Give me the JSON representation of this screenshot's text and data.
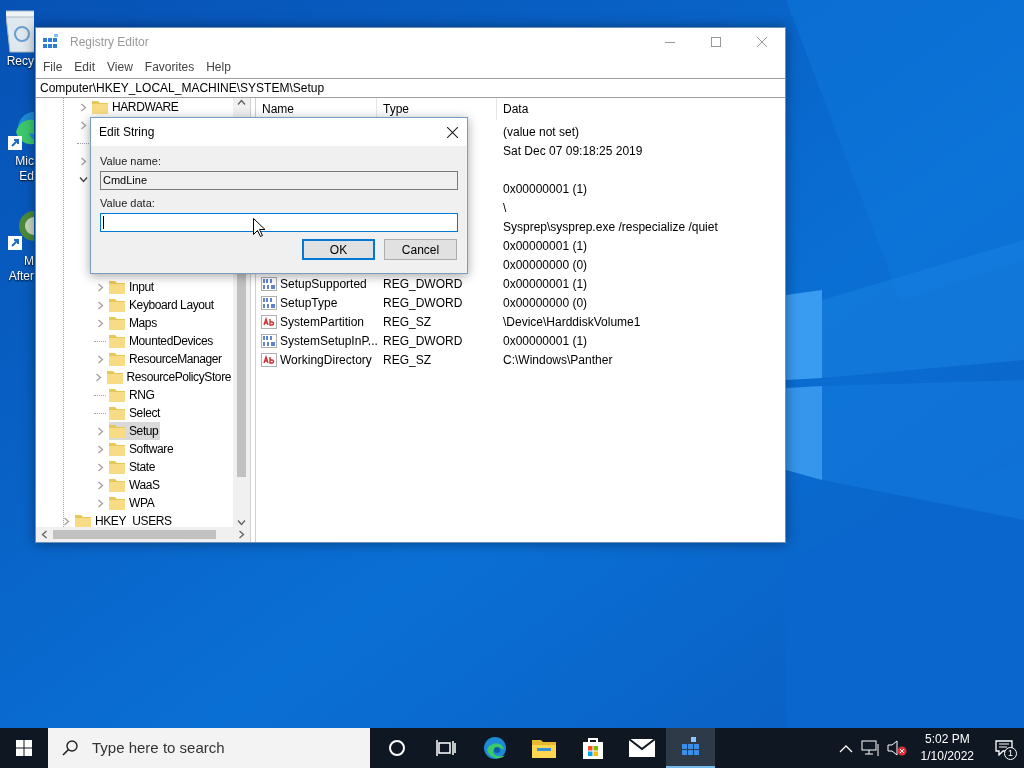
{
  "desktop_icons": [
    {
      "kind": "recycle-bin",
      "lines": [
        "Recy"
      ]
    },
    {
      "kind": "edge",
      "lines": [
        "Mic",
        "Ed"
      ]
    },
    {
      "kind": "app",
      "lines": [
        "M",
        "After"
      ]
    }
  ],
  "window": {
    "title": "Registry Editor",
    "menu": [
      "File",
      "Edit",
      "View",
      "Favorites",
      "Help"
    ],
    "address": "Computer\\HKEY_LOCAL_MACHINE\\SYSTEM\\Setup",
    "tree": {
      "items": [
        {
          "children": [
            {
              "label": "HARDWARE",
              "kind": "branch",
              "expanded": false,
              "selected": false
            },
            {
              "kind": "branch",
              "expanded": false
            },
            {
              "kind": "leaf"
            },
            {
              "kind": "branch",
              "expanded": false
            },
            {
              "kind": "branch",
              "expanded": true,
              "children": [
                {
                  "label": "Input",
                  "kind": "branch",
                  "expanded": false,
                  "selected": false
                },
                {
                  "label": "Keyboard Layout",
                  "kind": "branch",
                  "expanded": false,
                  "selected": false
                },
                {
                  "label": "Maps",
                  "kind": "branch",
                  "expanded": false,
                  "selected": false
                },
                {
                  "label": "MountedDevices",
                  "kind": "leaf",
                  "selected": false
                },
                {
                  "label": "ResourceManager",
                  "kind": "branch",
                  "expanded": false,
                  "selected": false
                },
                {
                  "label": "ResourcePolicyStore",
                  "kind": "branch",
                  "expanded": false,
                  "selected": false
                },
                {
                  "label": "RNG",
                  "kind": "leaf",
                  "selected": false
                },
                {
                  "label": "Select",
                  "kind": "leaf",
                  "selected": false
                },
                {
                  "label": "Setup",
                  "kind": "branch",
                  "expanded": false,
                  "selected": true
                },
                {
                  "label": "Software",
                  "kind": "branch",
                  "expanded": false,
                  "selected": false
                },
                {
                  "label": "State",
                  "kind": "branch",
                  "expanded": false,
                  "selected": false
                },
                {
                  "label": "WaaS",
                  "kind": "branch",
                  "expanded": false,
                  "selected": false
                },
                {
                  "label": "WPA",
                  "kind": "branch",
                  "expanded": false,
                  "selected": false
                }
              ]
            }
          ]
        },
        {
          "label": "HKEY_USERS",
          "kind": "branch",
          "expanded": false,
          "selected": false
        }
      ]
    },
    "list": {
      "columns": [
        "Name",
        "Type",
        "Data"
      ],
      "rows": [
        {
          "data": "(value not set)"
        },
        {
          "data": "Sat Dec 07 09:18:25 2019"
        },
        {
          "kind": "blank"
        },
        {
          "data": "0x00000001 (1)"
        },
        {
          "data": "\\"
        },
        {
          "data": "Sysprep\\sysprep.exe /respecialize /quiet"
        },
        {
          "data": "0x00000001 (1)"
        },
        {
          "data": "0x00000000 (0)"
        },
        {
          "kind": "dword",
          "name": "SetupSupported",
          "type": "REG_DWORD",
          "data": "0x00000001 (1)"
        },
        {
          "kind": "dword",
          "name": "SetupType",
          "type": "REG_DWORD",
          "data": "0x00000000 (0)"
        },
        {
          "kind": "sz",
          "name": "SystemPartition",
          "type": "REG_SZ",
          "data": "\\Device\\HarddiskVolume1"
        },
        {
          "kind": "dword",
          "name": "SystemSetupInP...",
          "type": "REG_DWORD",
          "data": "0x00000001 (1)"
        },
        {
          "kind": "sz",
          "name": "WorkingDirectory",
          "type": "REG_SZ",
          "data": "C:\\Windows\\Panther"
        }
      ]
    }
  },
  "dialog": {
    "title": "Edit String",
    "fields": [
      {
        "label": "Value name:",
        "value": "CmdLine",
        "readonly": true,
        "focused": false
      },
      {
        "label": "Value data:",
        "readonly": false,
        "focused": true
      }
    ],
    "buttons": [
      {
        "label": "OK",
        "default": true
      },
      {
        "label": "Cancel",
        "default": false
      }
    ]
  },
  "taskbar": {
    "search_placeholder": "Type here to search",
    "apps": [
      {
        "kind": "cortana",
        "active": false
      },
      {
        "kind": "task-view",
        "active": false
      },
      {
        "kind": "edge",
        "active": false
      },
      {
        "kind": "explorer",
        "active": false
      },
      {
        "kind": "store",
        "active": false
      },
      {
        "kind": "mail",
        "active": false
      },
      {
        "kind": "regedit",
        "active": true
      }
    ],
    "volume_muted": true,
    "time": "5:02 PM",
    "date": "1/10/2022",
    "notification_count": "1"
  }
}
